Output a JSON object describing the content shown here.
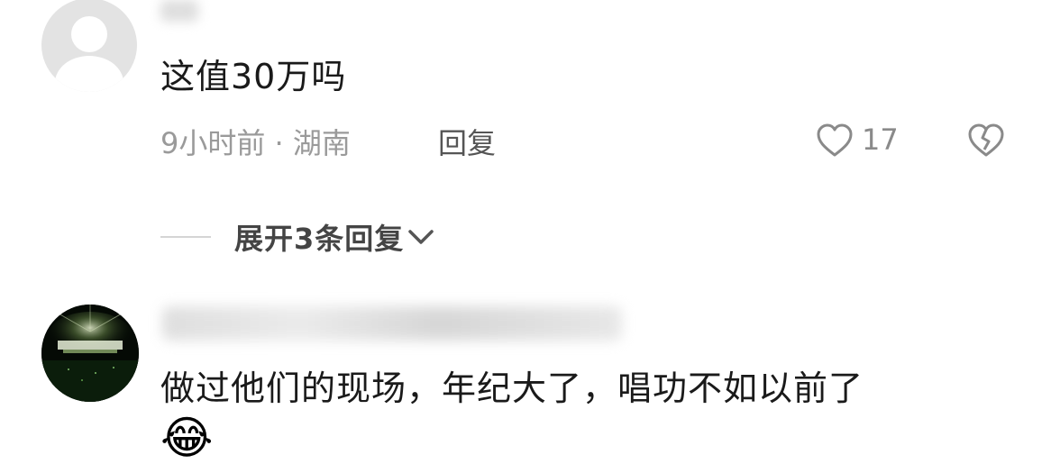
{
  "comments": [
    {
      "text": "这值30万吗",
      "meta": "9小时前 · 湖南",
      "reply_label": "回复",
      "like_count": "17",
      "expand_replies_label": "展开3条回复"
    },
    {
      "text": "做过他们的现场，年纪大了，唱功不如以前了",
      "emoji": "😂"
    }
  ],
  "icons": {
    "like": "heart-outline-icon",
    "dislike": "broken-heart-icon",
    "chevron": "chevron-down-icon"
  }
}
